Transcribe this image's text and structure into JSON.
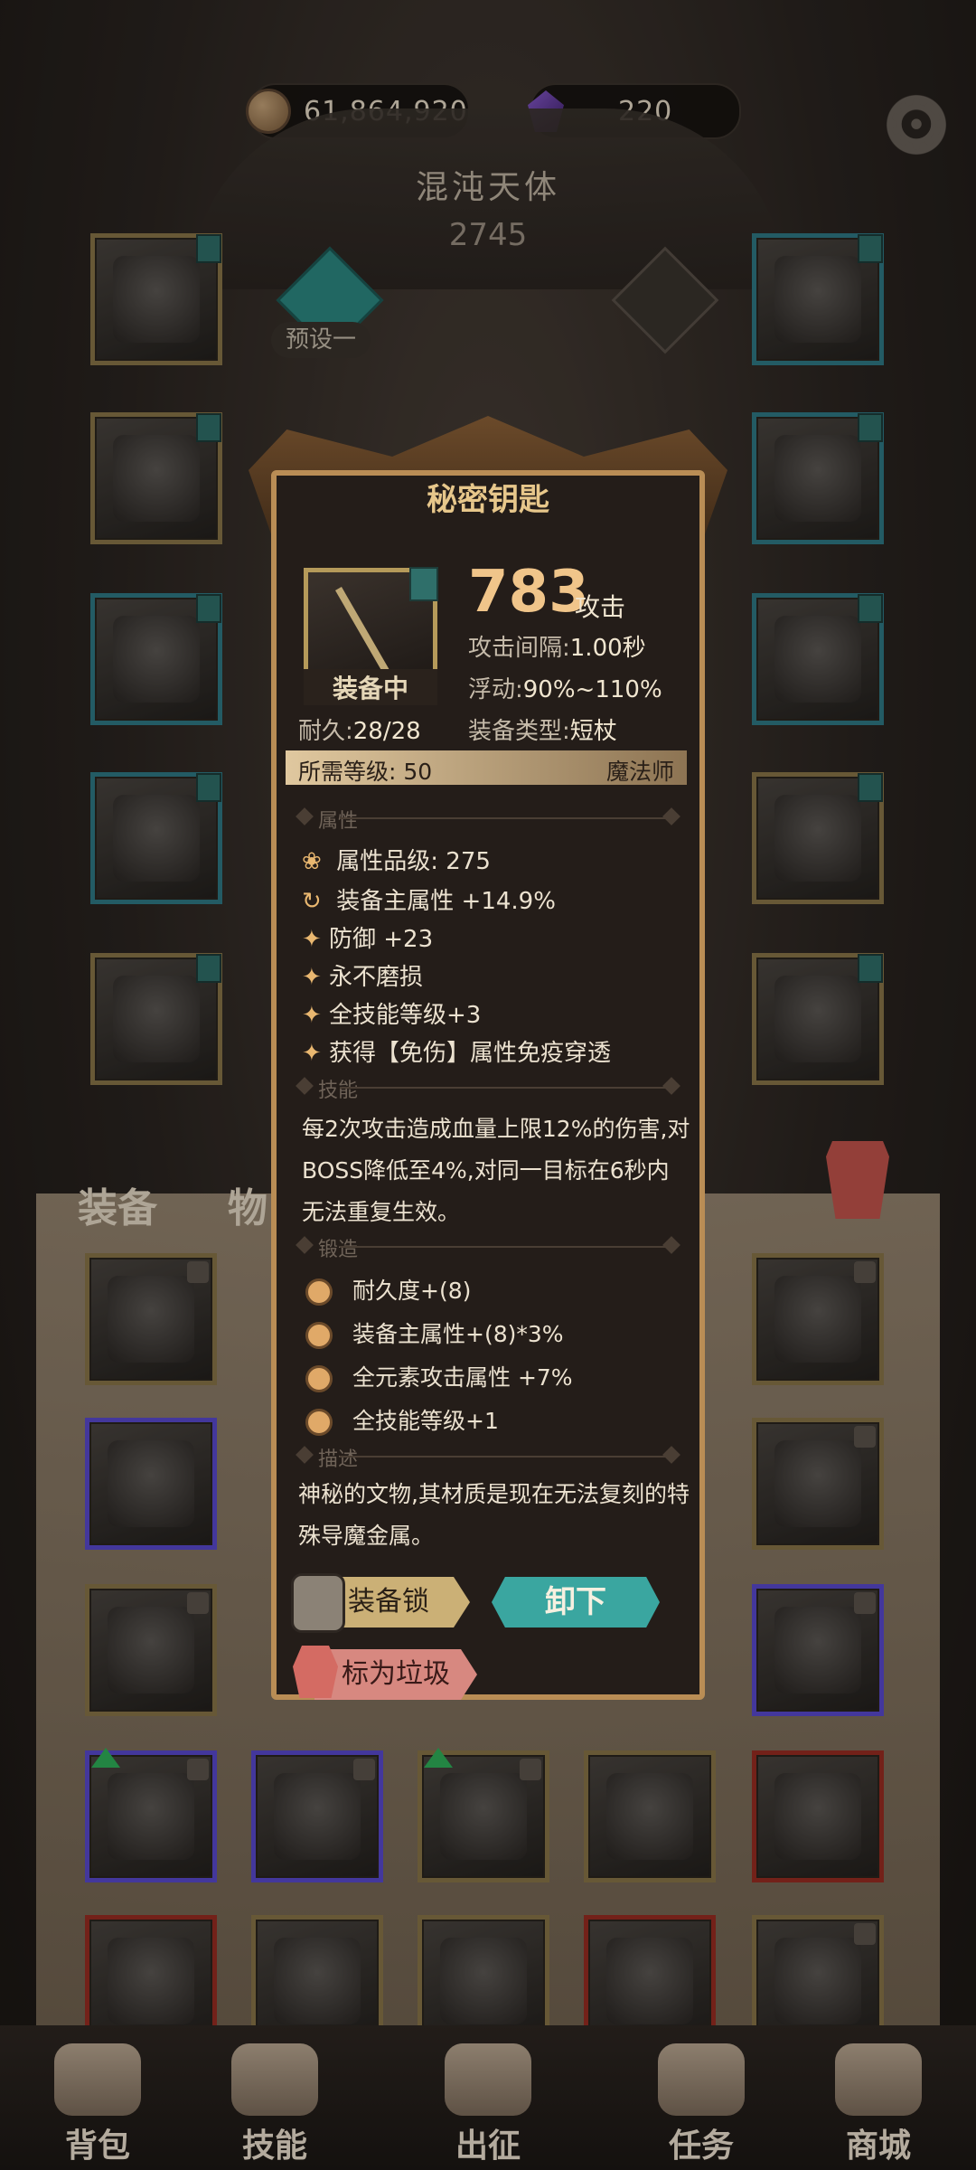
{
  "resources": {
    "coins": "61,864,920",
    "gems": "220"
  },
  "character": {
    "name": "混沌天体",
    "power": "2745",
    "preset": "预设一"
  },
  "inventory_tabs": {
    "equip": "装备",
    "items": "物"
  },
  "popup": {
    "title": "秘密钥匙",
    "equipped_badge": "装备中",
    "attack_value": "783",
    "attack_label": "攻击",
    "attack_interval_label": "攻击间隔:",
    "attack_interval": "1.00秒",
    "float_label": "浮动:",
    "float": "90%~110%",
    "durability_label": "耐久:",
    "durability": "28/28",
    "equip_type_label": "装备类型:",
    "equip_type": "短杖",
    "required_level": "所需等级: 50",
    "class": "魔法师",
    "sections": {
      "attributes": "属性",
      "skill": "技能",
      "forge": "锻造",
      "description": "描述"
    },
    "attributes": [
      "属性品级: 275",
      "装备主属性 +14.9%",
      "防御 +23",
      "永不磨损",
      "全技能等级+3",
      "获得【免伤】属性免疫穿透"
    ],
    "skill_text": "每2次攻击造成血量上限12%的伤害,对BOSS降低至4%,对同一目标在6秒内无法重复生效。",
    "forge": [
      "耐久度+(8)",
      "装备主属性+(8)*3%",
      "全元素攻击属性 +7%",
      "全技能等级+1"
    ],
    "description_text": "神秘的文物,其材质是现在无法复刻的特殊导魔金属。",
    "buttons": {
      "lock": "装备锁",
      "unequip": "卸下",
      "trash": "标为垃圾"
    }
  },
  "nav": [
    "背包",
    "技能",
    "出征",
    "任务",
    "商城"
  ],
  "colors": {
    "gold": "#b98d55",
    "teal": "#3aa6a0",
    "accent": "#f0c58a"
  }
}
